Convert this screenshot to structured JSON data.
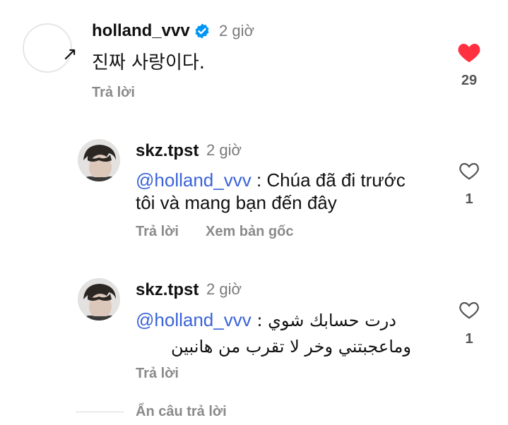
{
  "comments": [
    {
      "username": "holland_vvv",
      "time": "2 giờ",
      "text": "진짜 사랑이다.",
      "reply_label": "Trả lời",
      "like_count": "29",
      "liked": true,
      "avatar_glyph": "↗"
    },
    {
      "username": "skz.tpst",
      "time": "2 giờ",
      "mention": "@holland_vvv",
      "text_line1": " : Chúa đã đi trước",
      "text_line2": "tôi và mang bạn đến đây",
      "reply_label": "Trả lời",
      "see_original_label": "Xem bản gốc",
      "like_count": "1",
      "liked": false
    },
    {
      "username": "skz.tpst",
      "time": "2 giờ",
      "mention": "@holland_vvv",
      "text_line1": " : درت حسابك شوي",
      "text_line2": "وماعجبتني وخر لا تقرب من هانبين",
      "reply_label": "Trả lời",
      "like_count": "1",
      "liked": false
    }
  ],
  "hide_replies_label": "Ẩn câu trả lời",
  "colors": {
    "like_red": "#ff3040",
    "mention_blue": "#3a63d8",
    "verified_blue": "#0095f6"
  }
}
